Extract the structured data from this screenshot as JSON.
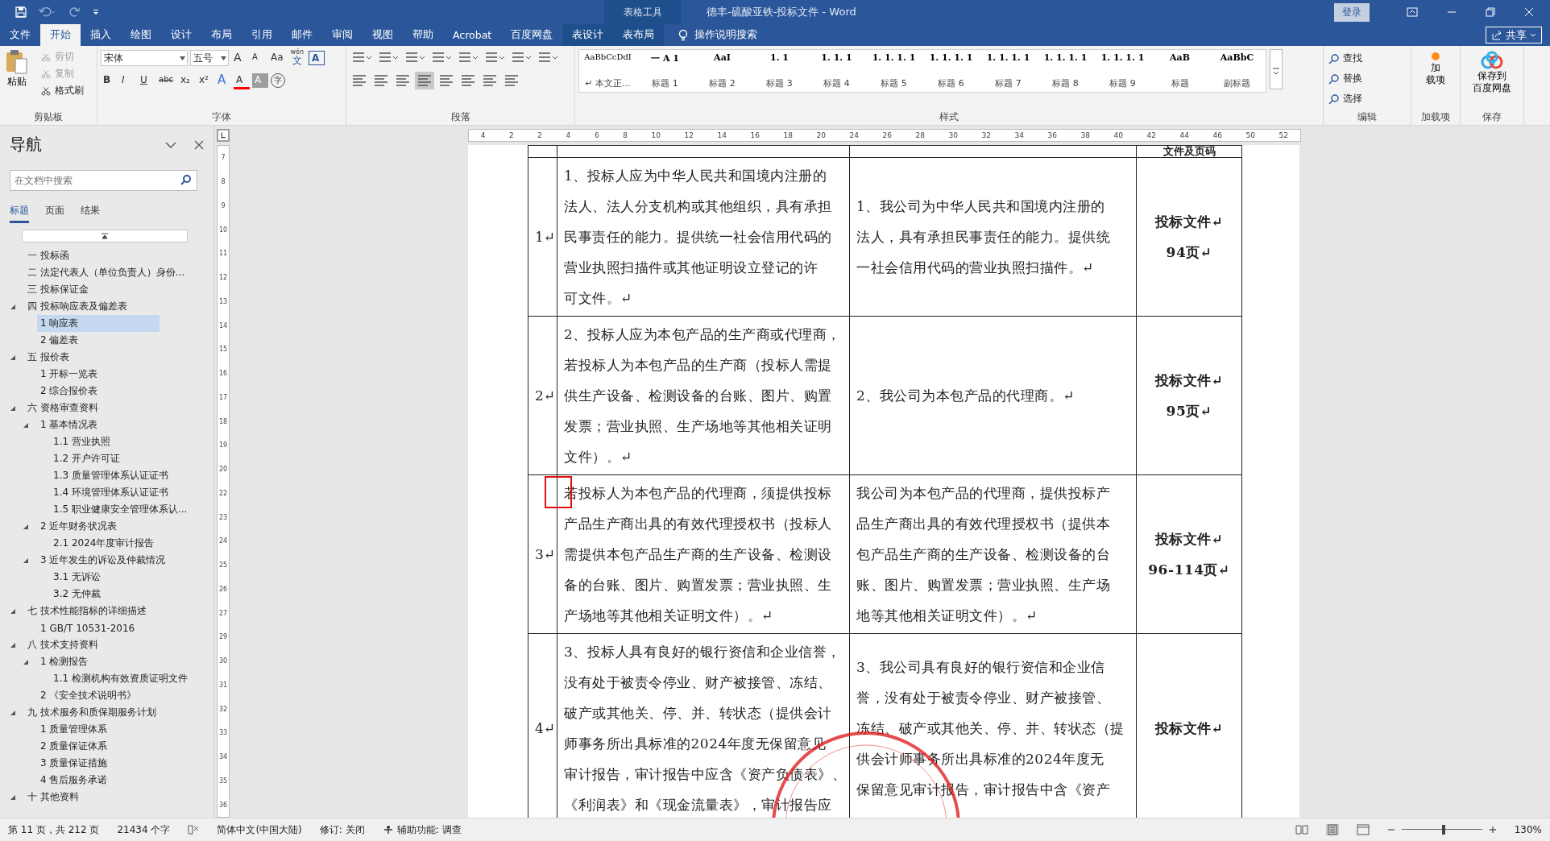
{
  "window": {
    "title": "德丰-硫酸亚铁-投标文件  -  Word",
    "context_group": "表格工具",
    "sign_in": "登录"
  },
  "ribbon_tabs": [
    {
      "label": "文件",
      "kind": "standard",
      "selected": false
    },
    {
      "label": "开始",
      "kind": "standard",
      "selected": true
    },
    {
      "label": "插入",
      "kind": "standard",
      "selected": false
    },
    {
      "label": "绘图",
      "kind": "standard",
      "selected": false
    },
    {
      "label": "设计",
      "kind": "standard",
      "selected": false
    },
    {
      "label": "布局",
      "kind": "standard",
      "selected": false
    },
    {
      "label": "引用",
      "kind": "standard",
      "selected": false
    },
    {
      "label": "邮件",
      "kind": "standard",
      "selected": false
    },
    {
      "label": "审阅",
      "kind": "standard",
      "selected": false
    },
    {
      "label": "视图",
      "kind": "standard",
      "selected": false
    },
    {
      "label": "帮助",
      "kind": "standard",
      "selected": false
    },
    {
      "label": "Acrobat",
      "kind": "standard",
      "selected": false
    },
    {
      "label": "百度网盘",
      "kind": "standard",
      "selected": false
    },
    {
      "label": "表设计",
      "kind": "contextual",
      "selected": false
    },
    {
      "label": "表布局",
      "kind": "contextual",
      "selected": false
    }
  ],
  "tell_me": "操作说明搜索",
  "share": "共享",
  "ribbon": {
    "clipboard": {
      "label": "剪贴板",
      "paste": "粘贴",
      "items": [
        {
          "label": "剪切",
          "disabled": true
        },
        {
          "label": "复制",
          "disabled": true
        },
        {
          "label": "格式刷",
          "disabled": false
        }
      ]
    },
    "font": {
      "label": "字体",
      "name": "宋体",
      "size": "五号",
      "row1": [
        {
          "kind": "grow",
          "label": "A"
        },
        {
          "kind": "shrink",
          "label": "A"
        },
        {
          "kind": "text",
          "label": "Aa"
        },
        {
          "kind": "phonetic",
          "top": "wén",
          "label": "文"
        },
        {
          "kind": "boxed",
          "label": "A"
        }
      ],
      "row2": [
        {
          "kind": "bold",
          "label": "B"
        },
        {
          "kind": "italic",
          "label": "I"
        },
        {
          "kind": "underline",
          "label": "U"
        },
        {
          "kind": "strike",
          "label": "abc"
        },
        {
          "kind": "text",
          "label": "x₂"
        },
        {
          "kind": "text",
          "label": "x²"
        },
        {
          "kind": "effect",
          "label": "A"
        },
        {
          "kind": "color",
          "label": "A",
          "color": "#ff0000"
        },
        {
          "kind": "shaded",
          "label": "A"
        },
        {
          "kind": "circled",
          "label": "字"
        }
      ]
    },
    "paragraph": {
      "label": "段落"
    },
    "styles": {
      "label": "样式",
      "items": [
        {
          "preview": "AaBbCcDdI",
          "name": "↵ 本文正..."
        },
        {
          "preview": "一  A 1",
          "name": "标题 1"
        },
        {
          "preview": "AaI",
          "name": "标题 2"
        },
        {
          "preview": "1. 1",
          "name": "标题 3"
        },
        {
          "preview": "1. 1. 1",
          "name": "标题 4"
        },
        {
          "preview": "1. 1. 1. 1",
          "name": "标题 5"
        },
        {
          "preview": "1. 1. 1. 1",
          "name": "标题 6"
        },
        {
          "preview": "1. 1. 1. 1",
          "name": "标题 7"
        },
        {
          "preview": "1. 1. 1. 1",
          "name": "标题 8"
        },
        {
          "preview": "1. 1. 1. 1",
          "name": "标题 9"
        },
        {
          "preview": "AaB",
          "name": "标题"
        },
        {
          "preview": "AaBbC",
          "name": "副标题"
        }
      ]
    },
    "editing": {
      "label": "编辑",
      "items": [
        "查找",
        "替换",
        "选择"
      ]
    },
    "addins": {
      "label": "加载项",
      "button": [
        "加",
        "载项"
      ]
    },
    "save": {
      "label": "保存",
      "button": [
        "保存到",
        "百度网盘"
      ]
    }
  },
  "nav": {
    "title": "导航",
    "search": {
      "placeholder": "在文档中搜索"
    },
    "tabs": [
      {
        "label": "标题",
        "selected": true
      },
      {
        "label": "页面",
        "selected": false
      },
      {
        "label": "结果",
        "selected": false
      }
    ],
    "tree": [
      {
        "label": "一 投标函",
        "expanded": false,
        "selected": false
      },
      {
        "label": "二 法定代表人（单位负责人）身份...",
        "expanded": false,
        "selected": false
      },
      {
        "label": "三 投标保证金",
        "expanded": false,
        "selected": false
      },
      {
        "label": "四 投标响应表及偏差表",
        "expanded": true,
        "selected": false,
        "children": [
          {
            "label": "1 响应表",
            "expanded": false,
            "selected": true
          },
          {
            "label": "2 偏差表",
            "expanded": false,
            "selected": false
          }
        ]
      },
      {
        "label": "五 报价表",
        "expanded": true,
        "selected": false,
        "children": [
          {
            "label": "1 开标一览表",
            "expanded": false,
            "selected": false
          },
          {
            "label": "2 综合报价表",
            "expanded": false,
            "selected": false
          }
        ]
      },
      {
        "label": "六 资格审查资料",
        "expanded": true,
        "selected": false,
        "children": [
          {
            "label": "1 基本情况表",
            "expanded": true,
            "selected": false,
            "children": [
              {
                "label": "1.1 营业执照",
                "expanded": false,
                "selected": false
              },
              {
                "label": "1.2 开户许可证",
                "expanded": false,
                "selected": false
              },
              {
                "label": "1.3 质量管理体系认证证书",
                "expanded": false,
                "selected": false
              },
              {
                "label": "1.4 环境管理体系认证证书",
                "expanded": false,
                "selected": false
              },
              {
                "label": "1.5 职业健康安全管理体系认...",
                "expanded": false,
                "selected": false
              }
            ]
          },
          {
            "label": "2 近年财务状况表",
            "expanded": true,
            "selected": false,
            "children": [
              {
                "label": "2.1 2024年度审计报告",
                "expanded": false,
                "selected": false
              }
            ]
          },
          {
            "label": "3 近年发生的诉讼及仲裁情况",
            "expanded": true,
            "selected": false,
            "children": [
              {
                "label": "3.1 无诉讼",
                "expanded": false,
                "selected": false
              },
              {
                "label": "3.2 无仲裁",
                "expanded": false,
                "selected": false
              }
            ]
          }
        ]
      },
      {
        "label": "七 技术性能指标的详细描述",
        "expanded": true,
        "selected": false,
        "children": [
          {
            "label": "1 GB/T 10531-2016",
            "expanded": false,
            "selected": false
          }
        ]
      },
      {
        "label": "八 技术支持资料",
        "expanded": true,
        "selected": false,
        "children": [
          {
            "label": "1 检测报告",
            "expanded": true,
            "selected": false,
            "children": [
              {
                "label": "1.1 检测机构有效资质证明文件",
                "expanded": false,
                "selected": false
              }
            ]
          },
          {
            "label": "2 《安全技术说明书》",
            "expanded": false,
            "selected": false
          }
        ]
      },
      {
        "label": "九 技术服务和质保期服务计划",
        "expanded": true,
        "selected": false,
        "children": [
          {
            "label": "1 质量管理体系",
            "expanded": false,
            "selected": false
          },
          {
            "label": "2 质量保证体系",
            "expanded": false,
            "selected": false
          },
          {
            "label": "3 质量保证措施",
            "expanded": false,
            "selected": false
          },
          {
            "label": "4 售后服务承诺",
            "expanded": false,
            "selected": false
          }
        ]
      },
      {
        "label": "十 其他资料",
        "expanded": true,
        "selected": false
      }
    ]
  },
  "ruler": {
    "horizontal": [
      "4",
      "2",
      "2",
      "4",
      "6",
      "8",
      "10",
      "12",
      "14",
      "16",
      "18",
      "20",
      "24",
      "26",
      "28",
      "30",
      "32",
      "34",
      "36",
      "38",
      "40",
      "42",
      "44",
      "46",
      "50",
      "52"
    ],
    "vertical": [
      "7",
      "8",
      "9",
      "10",
      "11",
      "12",
      "13",
      "14",
      "15",
      "16",
      "17",
      "18",
      "19",
      "20",
      "22",
      "23",
      "24",
      "25",
      "26",
      "27",
      "29",
      "30",
      "31",
      "32",
      "33",
      "34",
      "35",
      "36"
    ]
  },
  "table": {
    "column_4_heading": "文件及页码",
    "rows": [
      {
        "number": "1↵",
        "selected": false,
        "requirement": [
          "1、投标人应为中华人民共和国境内注册的",
          "法人、法人分支机构或其他组织，具有承担",
          "民事责任的能力。提供统一社会信用代码的",
          "营业执照扫描件或其他证明设立登记的许",
          "可文件。↵"
        ],
        "response": [
          "1、我公司为中华人民共和国境内注册的",
          "法人，具有承担民事责任的能力。提供统",
          "一社会信用代码的营业执照扫描件。↵"
        ],
        "reference": [
          "投标文件↵",
          "94页↵"
        ]
      },
      {
        "number": "2↵",
        "selected": false,
        "requirement": [
          "2、投标人应为本包产品的生产商或代理商，",
          "若投标人为本包产品的生产商（投标人需提",
          "供生产设备、检测设备的台账、图片、购置",
          "发票；营业执照、生产场地等其他相关证明",
          "文件）。↵"
        ],
        "response": [
          "2、我公司为本包产品的代理商。↵"
        ],
        "reference": [
          "投标文件↵",
          "95页↵"
        ]
      },
      {
        "number": "3↵",
        "selected": true,
        "requirement": [
          "若投标人为本包产品的代理商，须提供投标",
          "产品生产商出具的有效代理授权书（投标人",
          "需提供本包产品生产商的生产设备、检测设",
          "备的台账、图片、购置发票；营业执照、生",
          "产场地等其他相关证明文件）。↵"
        ],
        "response": [
          "我公司为本包产品的代理商，提供投标产",
          "品生产商出具的有效代理授权书（提供本",
          "包产品生产商的生产设备、检测设备的台",
          "账、图片、购置发票；营业执照、生产场",
          "地等其他相关证明文件）。↵"
        ],
        "reference": [
          "投标文件↵",
          "96-114页↵"
        ]
      },
      {
        "number": "4↵",
        "selected": false,
        "requirement": [
          "3、投标人具有良好的银行资信和企业信誉，",
          "没有处于被责令停业、财产被接管、冻结、",
          "破产或其他关、停、并、转状态（提供会计",
          "师事务所出具标准的2024年度无保留意见",
          "审计报告，审计报告中应含《资产负债表》、",
          "《利润表》和《现金流量表》，审计报告应"
        ],
        "response": [
          "3、我公司具有良好的银行资信和企业信",
          "誉，没有处于被责令停业、财产被接管、",
          "冻结、破产或其他关、停、并、转状态（提",
          "供会计师事务所出具标准的2024年度无",
          "保留意见审计报告，审计报告中含《资产"
        ],
        "reference": [
          "投标文件↵"
        ]
      }
    ]
  },
  "status_bar": {
    "page": "第 11 页，共 212 页",
    "words": "21434 个字",
    "language": "简体中文(中国大陆)",
    "track_changes": "修订: 关闭",
    "accessibility": "辅助功能: 调查",
    "zoom": "130%",
    "zoom_slider": {
      "level": 0.52
    }
  }
}
